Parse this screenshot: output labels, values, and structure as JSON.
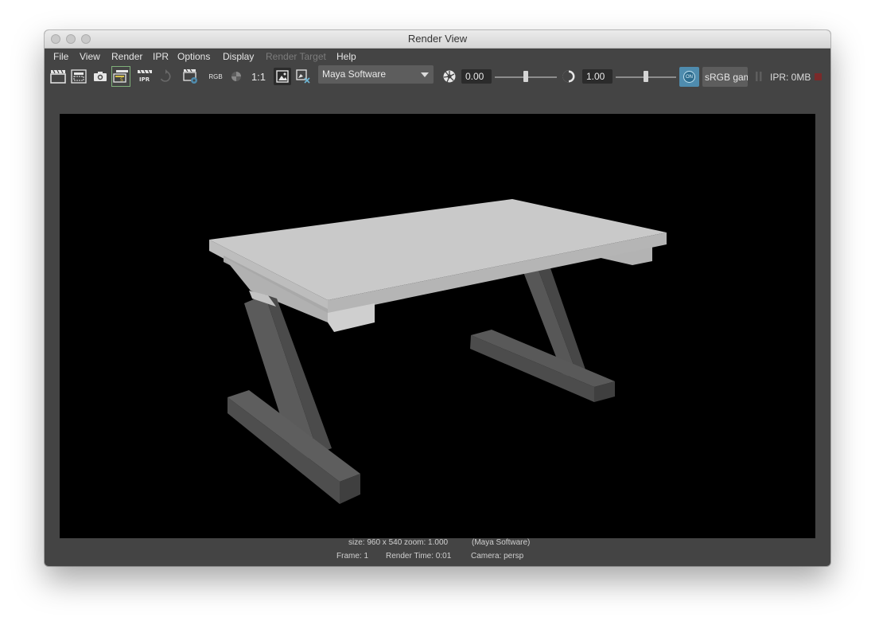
{
  "window": {
    "title": "Render View"
  },
  "menu": {
    "file": "File",
    "view": "View",
    "render": "Render",
    "ipr": "IPR",
    "options": "Options",
    "display": "Display",
    "render_target": "Render Target",
    "help": "Help"
  },
  "toolbar": {
    "rgb_label": "RGB",
    "ratio_label": "1:1",
    "renderer": "Maya Software",
    "exposure_value": "0.00",
    "exposure_level": 0.5,
    "gamma_value": "1.00",
    "gamma_level": 0.5,
    "colorspace_toggle": "ON",
    "colorspace": "sRGB gam",
    "ipr_memory": "IPR: 0MB",
    "colors": {
      "accent": "#4f8cae",
      "stop": "#7a2a2a"
    }
  },
  "image": {
    "description_icon": "render-preview-image",
    "colors": {
      "top": "#c9c9c9",
      "edge": "#bdbdbd",
      "leg_front": "#5e5e5e",
      "leg_side": "#4a4a4a"
    }
  },
  "status": {
    "size": "size: 960 x 540 zoom: 1.000",
    "renderer": "(Maya Software)",
    "frame": "Frame: 1",
    "render_time": "Render Time: 0:01",
    "camera": "Camera: persp"
  }
}
